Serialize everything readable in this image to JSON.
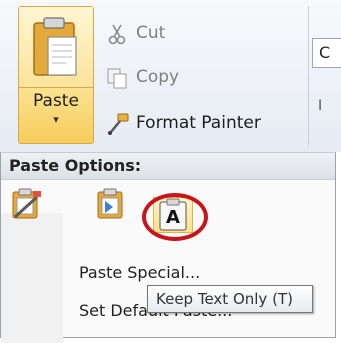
{
  "ribbon": {
    "paste_label": "Paste",
    "paste_arrow": "▾",
    "cut_label": "Cut",
    "copy_label": "Copy",
    "format_painter_label": "Format Painter",
    "font_box_glyph": "C",
    "font_row_glyph": "I"
  },
  "paste_menu": {
    "header": "Paste Options:",
    "option_icons": [
      "keep-source-formatting-icon",
      "merge-formatting-icon",
      "keep-text-only-icon"
    ],
    "text_only_glyph": "A",
    "item_paste_special": "Paste Special...",
    "item_set_default": "Set Default Paste...",
    "tooltip": "Keep Text Only (T)"
  },
  "colors": {
    "highlight_ring": "#c4161c",
    "selected_bg": "#fde08a",
    "selected_border": "#e0b34d"
  }
}
